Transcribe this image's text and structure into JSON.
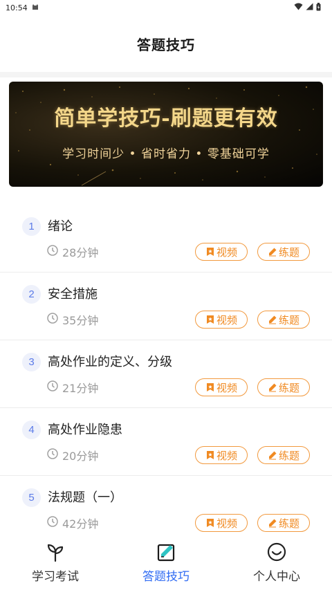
{
  "status_bar": {
    "time": "10:54"
  },
  "header": {
    "title": "答题技巧"
  },
  "banner": {
    "title": "简单学技巧-刷题更有效",
    "subtitle": "学习时间少 • 省时省力 • 零基础可学"
  },
  "lessons": [
    {
      "num": "1",
      "title": "绪论",
      "duration": "28分钟",
      "video": "视频",
      "practice": "练题"
    },
    {
      "num": "2",
      "title": "安全措施",
      "duration": "35分钟",
      "video": "视频",
      "practice": "练题"
    },
    {
      "num": "3",
      "title": "高处作业的定义、分级",
      "duration": "21分钟",
      "video": "视频",
      "practice": "练题"
    },
    {
      "num": "4",
      "title": "高处作业隐患",
      "duration": "20分钟",
      "video": "视频",
      "practice": "练题"
    },
    {
      "num": "5",
      "title": "法规题（一）",
      "duration": "42分钟",
      "video": "视频",
      "practice": "练题"
    }
  ],
  "nav": {
    "items": [
      {
        "label": "学习考试",
        "icon": "sprout-icon"
      },
      {
        "label": "答题技巧",
        "icon": "edit-icon",
        "active": true
      },
      {
        "label": "个人中心",
        "icon": "smile-icon"
      }
    ],
    "active_color": "#2f6bf3"
  },
  "colors": {
    "accent": "#f08a22",
    "number_bg": "#eef1fb",
    "number_fg": "#5b7be8"
  }
}
